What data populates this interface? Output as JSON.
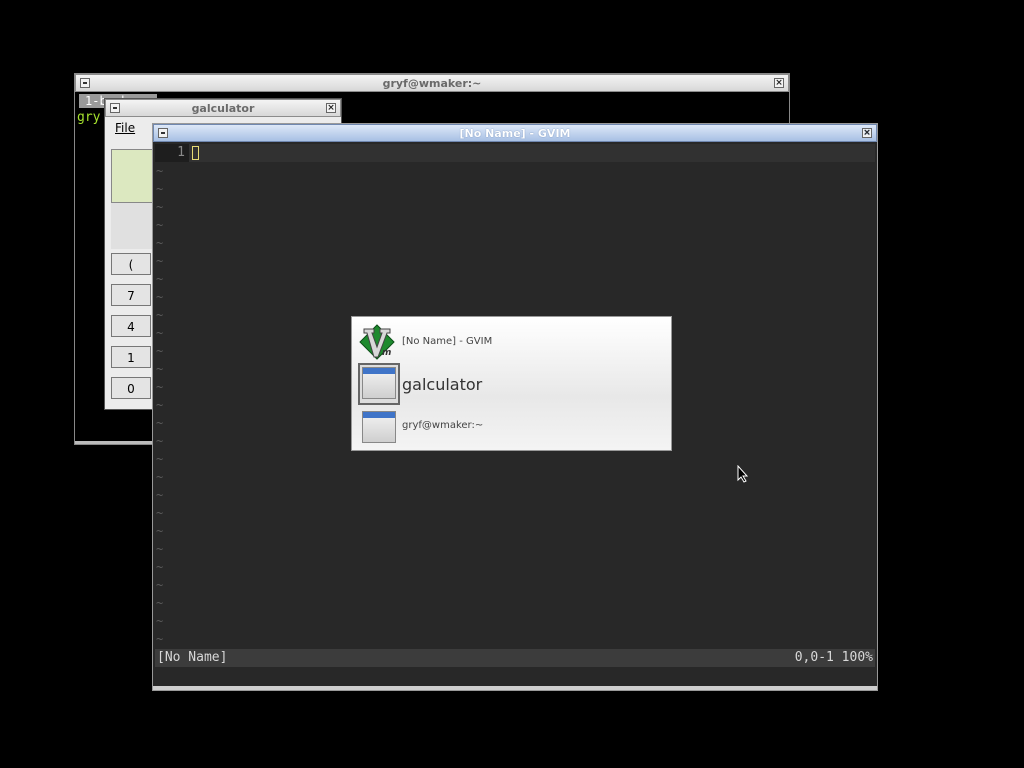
{
  "terminal": {
    "title": "gryf@wmaker:~",
    "tab_label": "1-bash",
    "prompt": "gry"
  },
  "galculator": {
    "title": "galculator",
    "menu_file": "File",
    "buttons": [
      "(",
      "7",
      "4",
      "1",
      "0"
    ]
  },
  "gvim": {
    "title": "[No Name] - GVIM",
    "line_number": "1",
    "status_left": "[No Name]",
    "status_right": "0,0-1 100%"
  },
  "switcher": {
    "items": [
      {
        "label": "[No Name] - GVIM",
        "icon": "vim-icon"
      },
      {
        "label": "galculator",
        "icon": "window-icon"
      },
      {
        "label": "gryf@wmaker:~",
        "icon": "window-icon"
      }
    ]
  },
  "colors": {
    "prompt_green": "#a6e22e",
    "cursor_yellow": "#e6db74",
    "editor_bg": "#282828"
  }
}
